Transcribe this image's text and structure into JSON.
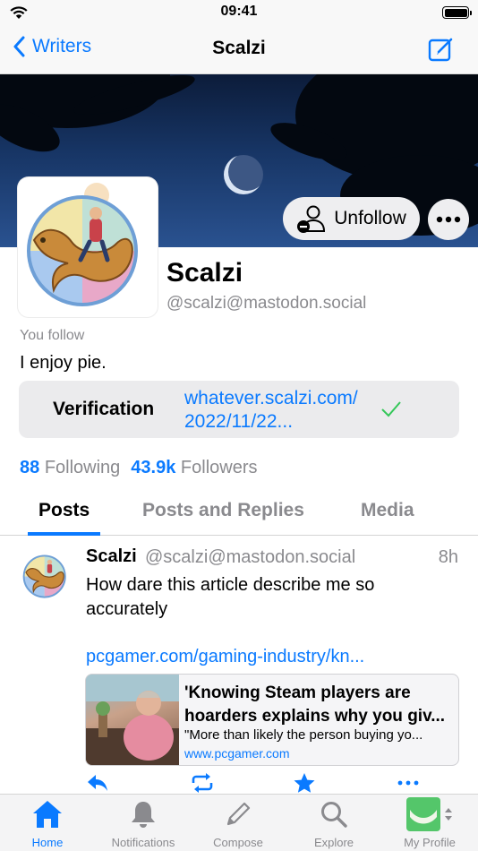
{
  "status_bar": {
    "time": "09:41"
  },
  "nav": {
    "back_label": "Writers",
    "title": "Scalzi"
  },
  "profile": {
    "display_name": "Scalzi",
    "handle": "@scalzi@mastodon.social",
    "follow_status": "You follow",
    "bio": "I enjoy pie.",
    "unfollow_label": "Unfollow",
    "verification": {
      "label": "Verification",
      "link_line1": "whatever.scalzi.com/",
      "link_line2": "2022/11/22..."
    },
    "stats": {
      "following_count": "88",
      "following_label": "Following",
      "followers_count": "43.9k",
      "followers_label": "Followers"
    }
  },
  "tabs": [
    "Posts",
    "Posts and Replies",
    "Media"
  ],
  "post": {
    "author_name": "Scalzi",
    "author_handle": "@scalzi@mastodon.social",
    "time": "8h",
    "text": "How dare this article describe me so accurately",
    "link": "pcgamer.com/gaming-industry/kn...",
    "card": {
      "title_line1": "'Knowing Steam players are",
      "title_line2": "hoarders explains why you giv...",
      "description": "\"More than likely the person buying yo...",
      "domain": "www.pcgamer.com"
    }
  },
  "tabbar": {
    "items": [
      {
        "label": "Home",
        "icon": "house-icon"
      },
      {
        "label": "Notifications",
        "icon": "bell-icon"
      },
      {
        "label": "Compose",
        "icon": "pencil-icon"
      },
      {
        "label": "Explore",
        "icon": "magnifier-icon"
      },
      {
        "label": "My Profile",
        "icon": "profile-avatar"
      }
    ]
  },
  "colors": {
    "accent": "#0a7aff",
    "secondary_text": "#8a8a8e",
    "verified": "#34c759"
  }
}
